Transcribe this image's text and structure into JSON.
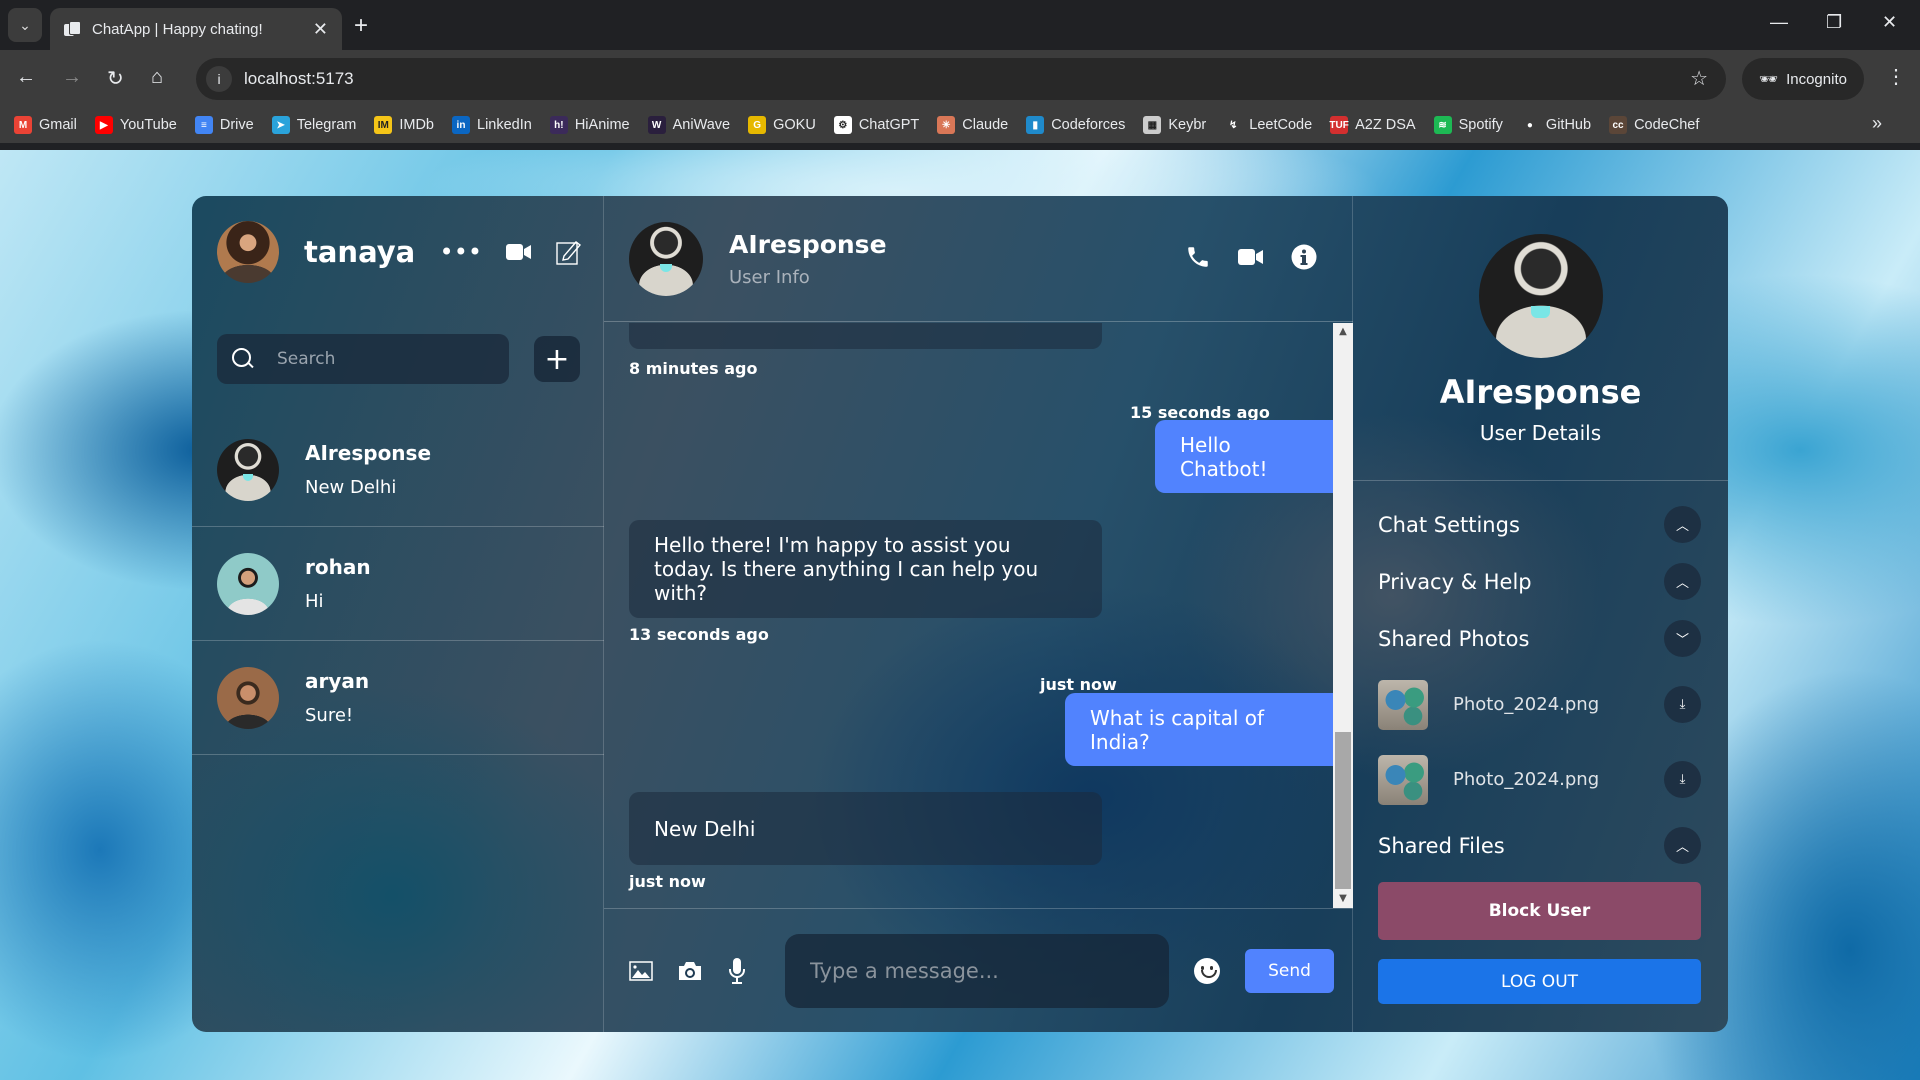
{
  "browser": {
    "tab_title": "ChatApp | Happy chating!",
    "url": "localhost:5173",
    "profile_label": "Incognito",
    "bookmarks": [
      {
        "label": "Gmail",
        "icon": "gmail-icon",
        "color": "#ea4335",
        "glyph": "M"
      },
      {
        "label": "YouTube",
        "icon": "youtube-icon",
        "color": "#ff0000",
        "glyph": "▶"
      },
      {
        "label": "Drive",
        "icon": "drive-icon",
        "color": "#4285f4",
        "glyph": "≡"
      },
      {
        "label": "Telegram",
        "icon": "telegram-icon",
        "color": "#2aa3db",
        "glyph": "➤"
      },
      {
        "label": "IMDb",
        "icon": "imdb-icon",
        "color": "#f5c518",
        "glyph": "IM"
      },
      {
        "label": "LinkedIn",
        "icon": "linkedin-icon",
        "color": "#0a66c2",
        "glyph": "in"
      },
      {
        "label": "HiAnime",
        "icon": "hianime-icon",
        "color": "#3b2a5a",
        "glyph": "h!"
      },
      {
        "label": "AniWave",
        "icon": "aniwave-icon",
        "color": "#2a1f3d",
        "glyph": "W"
      },
      {
        "label": "GOKU",
        "icon": "goku-icon",
        "color": "#e6b800",
        "glyph": "G"
      },
      {
        "label": "ChatGPT",
        "icon": "chatgpt-icon",
        "color": "#ffffff",
        "glyph": "⚙"
      },
      {
        "label": "Claude",
        "icon": "claude-icon",
        "color": "#d97757",
        "glyph": "✳"
      },
      {
        "label": "Codeforces",
        "icon": "codeforces-icon",
        "color": "#1f8acb",
        "glyph": "▮"
      },
      {
        "label": "Keybr",
        "icon": "keybr-icon",
        "color": "#cccccc",
        "glyph": "▦"
      },
      {
        "label": "LeetCode",
        "icon": "leetcode-icon",
        "color": "#3c3c3c",
        "glyph": "↯"
      },
      {
        "label": "A2Z DSA",
        "icon": "takeuforward-icon",
        "color": "#d32f2f",
        "glyph": "TUF"
      },
      {
        "label": "Spotify",
        "icon": "spotify-icon",
        "color": "#1db954",
        "glyph": "≋"
      },
      {
        "label": "GitHub",
        "icon": "github-icon",
        "color": "#3c3c3c",
        "glyph": "●"
      },
      {
        "label": "CodeChef",
        "icon": "codechef-icon",
        "color": "#5b4638",
        "glyph": "cc"
      }
    ]
  },
  "current_user": {
    "name": "tanaya"
  },
  "search": {
    "placeholder": "Search",
    "value": ""
  },
  "chat_list": [
    {
      "name": "AIresponse",
      "last_message": "New Delhi",
      "avatar": "robot"
    },
    {
      "name": "rohan",
      "last_message": "Hi",
      "avatar": "rohan"
    },
    {
      "name": "aryan",
      "last_message": "Sure!",
      "avatar": "aryan"
    }
  ],
  "active_chat": {
    "name": "AIresponse",
    "subtitle": "User Info",
    "messages": [
      {
        "sender": "bot",
        "text": "",
        "time": "8 minutes ago"
      },
      {
        "sender": "me",
        "text": "Hello Chatbot!",
        "time": "15 seconds ago"
      },
      {
        "sender": "bot",
        "text": "Hello there! I'm happy to assist you today. Is there anything I can help you with?",
        "time": "13 seconds ago"
      },
      {
        "sender": "me",
        "text": "What is capital of India?",
        "time": "just now"
      },
      {
        "sender": "bot",
        "text": "New Delhi",
        "time": "just now"
      }
    ],
    "scroll_position": 1.0
  },
  "composer": {
    "placeholder": "Type a message...",
    "value": "",
    "send_label": "Send"
  },
  "details": {
    "name": "AIresponse",
    "subtitle": "User Details",
    "sections": [
      {
        "title": "Chat Settings",
        "state": "collapsed"
      },
      {
        "title": "Privacy & Help",
        "state": "collapsed"
      },
      {
        "title": "Shared Photos",
        "state": "expanded"
      },
      {
        "title": "Shared Files",
        "state": "collapsed"
      }
    ],
    "shared_photos": [
      {
        "filename": "Photo_2024.png"
      },
      {
        "filename": "Photo_2024.png"
      }
    ],
    "block_label": "Block User",
    "logout_label": "LOG OUT"
  },
  "colors": {
    "accent": "#5183fe",
    "block": "#8b4a68",
    "logout": "#1b74e8"
  }
}
